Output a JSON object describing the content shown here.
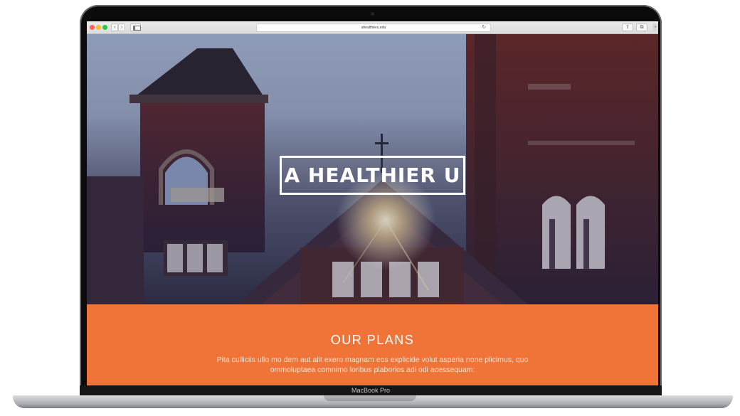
{
  "browser": {
    "url": "ahealthieru.edu",
    "back_icon": "‹",
    "forward_icon": "›",
    "reload_icon": "↻",
    "share_icon": "⇪",
    "tabs_icon": "⧉",
    "add_icon": "+"
  },
  "hero": {
    "brand": "A HEALTHIER U"
  },
  "plans": {
    "title": "OUR PLANS",
    "body": "Pita culliciis ullo mo dem aut alit exero magnam eos explicide volut asperia none plicimus, quo ommoluptaea comnimo loribus plaborios adi odi acessequam:"
  },
  "device": {
    "model": "MacBook Pro"
  },
  "colors": {
    "accent": "#f07437",
    "hero_sky": "#a9b8d4",
    "brick": "#5a2a2e"
  }
}
